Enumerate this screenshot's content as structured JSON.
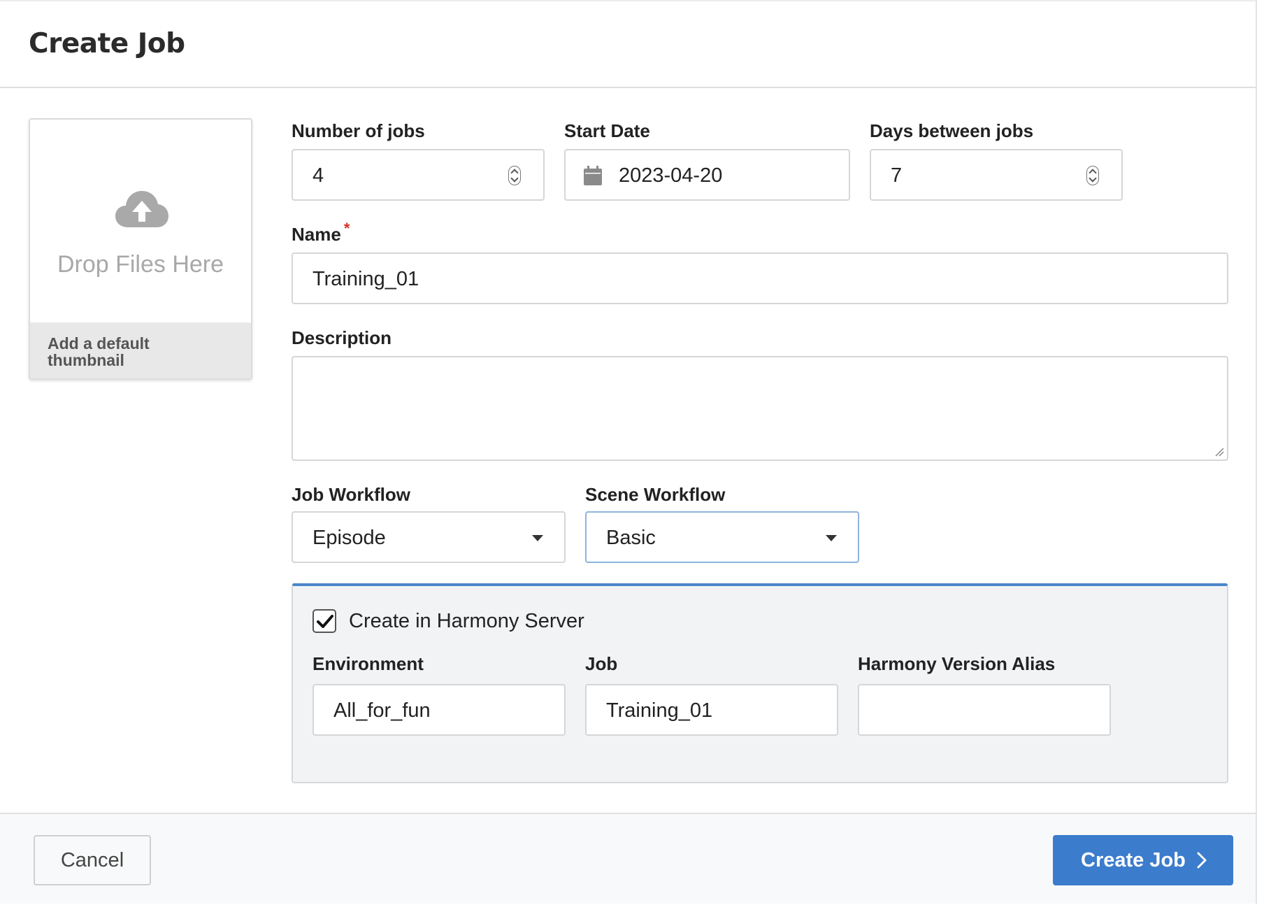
{
  "dialog": {
    "title": "Create Job"
  },
  "thumbnail": {
    "drop_text": "Drop Files Here",
    "footer_text": "Add a default thumbnail",
    "icon": "cloud-upload-icon"
  },
  "form": {
    "number_of_jobs": {
      "label": "Number of jobs",
      "value": "4"
    },
    "start_date": {
      "label": "Start Date",
      "value": "2023-04-20",
      "icon": "calendar-icon"
    },
    "days_between_jobs": {
      "label": "Days between jobs",
      "value": "7"
    },
    "name": {
      "label": "Name",
      "required_mark": "*",
      "value": "Training_01"
    },
    "description": {
      "label": "Description",
      "value": ""
    },
    "job_workflow": {
      "label": "Job Workflow",
      "selected": "Episode"
    },
    "scene_workflow": {
      "label": "Scene Workflow",
      "selected": "Basic"
    }
  },
  "harmony": {
    "checkbox_label": "Create in Harmony Server",
    "checked": true,
    "environment": {
      "label": "Environment",
      "value": "All_for_fun"
    },
    "job": {
      "label": "Job",
      "value": "Training_01"
    },
    "version_alias": {
      "label": "Harmony Version Alias",
      "value": ""
    }
  },
  "footer": {
    "cancel_label": "Cancel",
    "create_label": "Create Job"
  },
  "colors": {
    "primary": "#3b7ccc",
    "panel_accent": "#4a86c8",
    "required": "#d93025"
  }
}
